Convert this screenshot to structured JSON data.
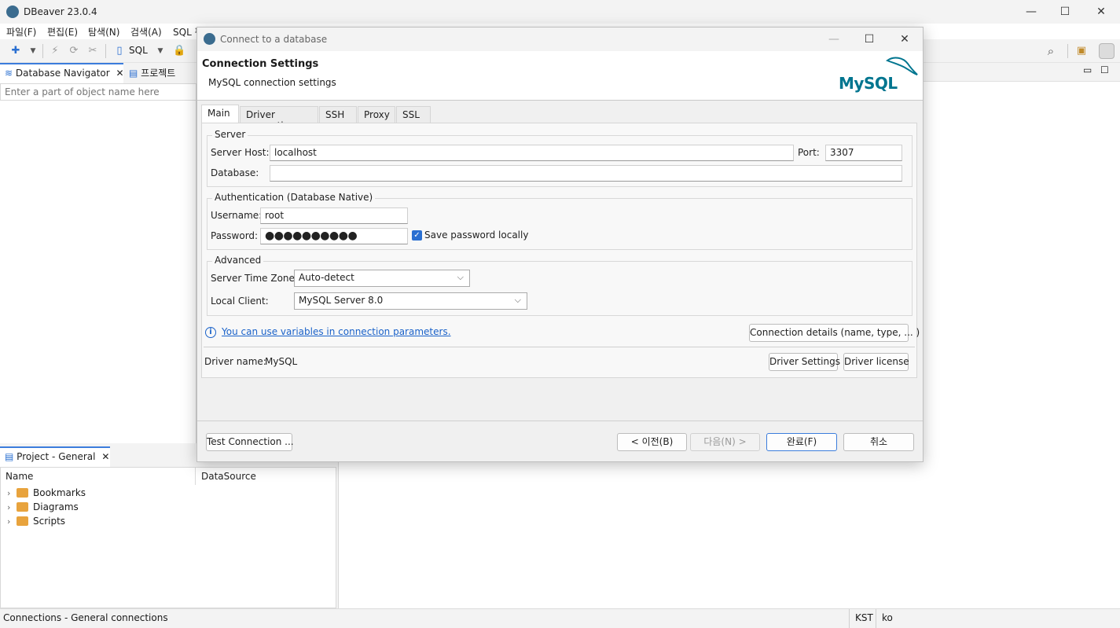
{
  "app": {
    "title": "DBeaver 23.0.4",
    "window_controls": {
      "minimize": "—",
      "maximize": "☐",
      "close": "✕"
    }
  },
  "menu": [
    "파일(F)",
    "편집(E)",
    "탐색(N)",
    "검색(A)",
    "SQL 편집기"
  ],
  "toolbar": {
    "sql_label": "SQL"
  },
  "navigator": {
    "tabs": [
      {
        "label": "Database Navigator"
      },
      {
        "label": "프로젝트"
      }
    ],
    "filter_placeholder": "Enter a part of object name here"
  },
  "project": {
    "tab_label": "Project - General",
    "columns": [
      "Name",
      "DataSource"
    ],
    "items": [
      "Bookmarks",
      "Diagrams",
      "Scripts"
    ]
  },
  "statusbar": {
    "left": "Connections - General connections",
    "tz": "KST",
    "locale": "ko"
  },
  "dialog": {
    "title": "Connect to a database",
    "header_title": "Connection Settings",
    "header_subtitle": "MySQL connection settings",
    "logo_text": "MySQL",
    "tabs": [
      "Main",
      "Driver properties",
      "SSH",
      "Proxy",
      "SSL"
    ],
    "server": {
      "group": "Server",
      "host_label": "Server Host:",
      "host_value": "localhost",
      "port_label": "Port:",
      "port_value": "3307",
      "database_label": "Database:",
      "database_value": ""
    },
    "auth": {
      "group": "Authentication (Database Native)",
      "username_label": "Username:",
      "username_value": "root",
      "password_label": "Password:",
      "password_mask": "●●●●●●●●●●",
      "save_password_label": "Save password locally"
    },
    "advanced": {
      "group": "Advanced",
      "timezone_label": "Server Time Zone:",
      "timezone_value": "Auto-detect",
      "client_label": "Local Client:",
      "client_value": "MySQL Server 8.0"
    },
    "variables_link": "You can use variables in connection parameters.",
    "connection_details_button": "Connection details (name, type, ... )",
    "driver_name_label": "Driver name:",
    "driver_name_value": "MySQL",
    "driver_settings_button": "Driver Settings",
    "driver_license_button": "Driver license",
    "test_connection_button": "Test Connection ...",
    "back_button": "< 이전(B)",
    "next_button": "다음(N) >",
    "finish_button": "완료(F)",
    "cancel_button": "취소"
  }
}
